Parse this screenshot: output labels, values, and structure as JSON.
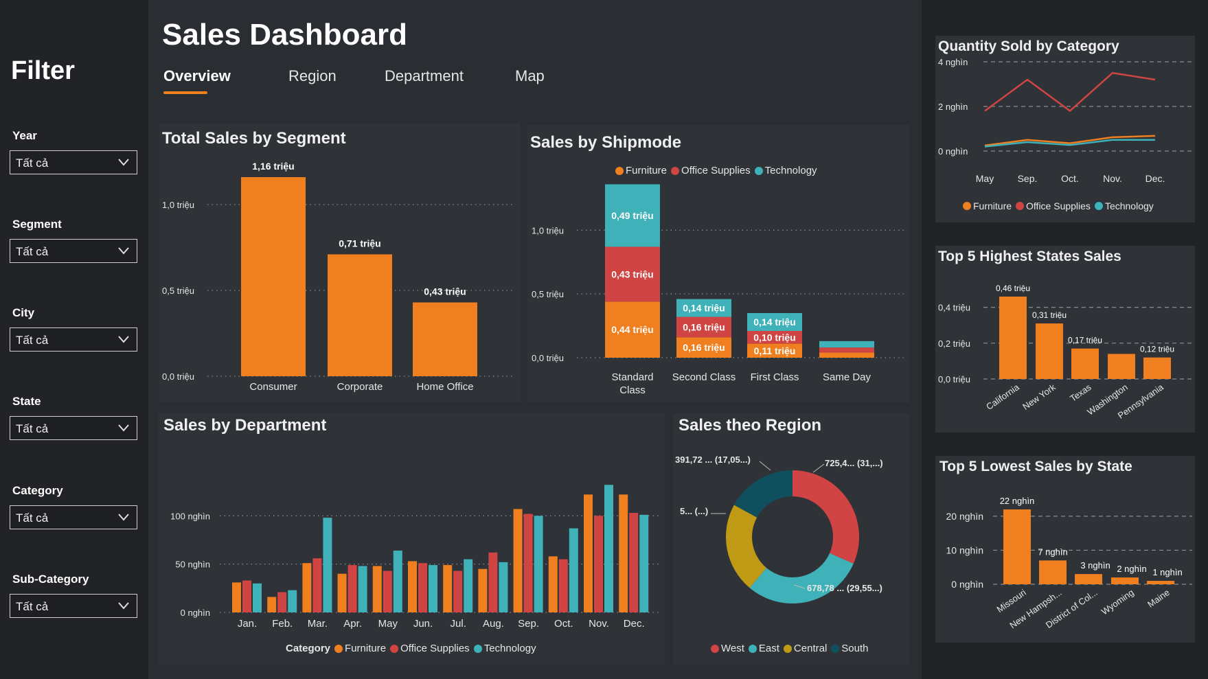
{
  "filter": {
    "title": "Filter",
    "fields": [
      {
        "label": "Year",
        "value": "Tất cả"
      },
      {
        "label": "Segment",
        "value": "Tất cả"
      },
      {
        "label": "City",
        "value": "Tất cả"
      },
      {
        "label": "State",
        "value": "Tất cả"
      },
      {
        "label": "Category",
        "value": "Tất cả"
      },
      {
        "label": "Sub-Category",
        "value": "Tất cả"
      }
    ]
  },
  "header": {
    "title": "Sales Dashboard",
    "tabs": [
      {
        "label": "Overview"
      },
      {
        "label": "Region"
      },
      {
        "label": "Department"
      },
      {
        "label": "Map"
      }
    ]
  },
  "colors": {
    "furniture": "#f07f1f",
    "office": "#d04444",
    "technology": "#3fb1b8",
    "central": "#c19a15",
    "south": "#10505e"
  },
  "chart_data": [
    {
      "id": "segment",
      "type": "bar",
      "title": "Total Sales by Segment",
      "categories": [
        "Consumer",
        "Corporate",
        "Home Office"
      ],
      "values": [
        1.16,
        0.71,
        0.43
      ],
      "data_labels": [
        "1,16 triệu",
        "0,71 triệu",
        "0,43 triệu"
      ],
      "yticks": [
        0,
        0.5,
        1.0
      ],
      "ytick_labels": [
        "0,0 triệu",
        "0,5 triệu",
        "1,0 triệu"
      ],
      "ylim": [
        0,
        1.2
      ],
      "grid": true,
      "color": "#f07f1f"
    },
    {
      "id": "shipmode",
      "type": "bar",
      "stacked": true,
      "title": "Sales by Shipmode",
      "categories": [
        "Standard\nClass",
        "Second Class",
        "First Class",
        "Same Day"
      ],
      "series": [
        {
          "name": "Furniture",
          "values": [
            0.44,
            0.16,
            0.11,
            0.04
          ],
          "labels": [
            "0,44 triệu",
            "0,16 triệu",
            "0,11 triệu",
            ""
          ],
          "color": "#f07f1f"
        },
        {
          "name": "Office Supplies",
          "values": [
            0.43,
            0.16,
            0.1,
            0.04
          ],
          "labels": [
            "0,43 triệu",
            "0,16 triệu",
            "0,10 triệu",
            ""
          ],
          "color": "#d04444"
        },
        {
          "name": "Technology",
          "values": [
            0.49,
            0.14,
            0.14,
            0.05
          ],
          "labels": [
            "0,49 triệu",
            "0,14 triệu",
            "0,14 triệu",
            ""
          ],
          "color": "#3fb1b8"
        }
      ],
      "yticks": [
        0,
        0.5,
        1.0
      ],
      "ytick_labels": [
        "0,0 triệu",
        "0,5 triệu",
        "1,0 triệu"
      ],
      "ylim": [
        0,
        1.4
      ],
      "grid": true,
      "legend": "top-center"
    },
    {
      "id": "department",
      "type": "bar",
      "title": "Sales by Department",
      "categories": [
        "Jan.",
        "Feb.",
        "Mar.",
        "Apr.",
        "May",
        "Jun.",
        "Jul.",
        "Aug.",
        "Sep.",
        "Oct.",
        "Nov.",
        "Dec."
      ],
      "series": [
        {
          "name": "Furniture",
          "values": [
            31,
            16,
            51,
            40,
            48,
            53,
            49,
            45,
            107,
            58,
            122,
            122
          ],
          "color": "#f07f1f"
        },
        {
          "name": "Office Supplies",
          "values": [
            33,
            21,
            56,
            49,
            43,
            51,
            43,
            62,
            102,
            55,
            100,
            103
          ],
          "color": "#d04444"
        },
        {
          "name": "Technology",
          "values": [
            30,
            23,
            98,
            48,
            64,
            49,
            55,
            52,
            100,
            87,
            132,
            101
          ],
          "color": "#3fb1b8"
        }
      ],
      "yticks": [
        0,
        50,
        100
      ],
      "ytick_labels": [
        "0 nghìn",
        "50 nghìn",
        "100 nghìn"
      ],
      "ylim": [
        0,
        135
      ],
      "grid": true,
      "legend_title": "Category",
      "legend": "bottom-center"
    },
    {
      "id": "region",
      "type": "pie",
      "donut": true,
      "title": "Sales theo Region",
      "labels": [
        "West",
        "East",
        "Central",
        "South"
      ],
      "values": [
        725.4,
        678.78,
        501.2,
        391.72
      ],
      "data_labels": [
        "725,4... (31,...)",
        "678,78 ... (29,55...)",
        "5... (...)",
        "391,72 ... (17,05...)"
      ],
      "colors": [
        "#d04444",
        "#3fb1b8",
        "#c19a15",
        "#10505e"
      ],
      "legend": "bottom-center"
    },
    {
      "id": "quantity",
      "type": "line",
      "title": "Quantity Sold by Category",
      "categories": [
        "May",
        "Sep.",
        "Oct.",
        "Nov.",
        "Dec."
      ],
      "series": [
        {
          "name": "Furniture",
          "values": [
            0.25,
            0.5,
            0.35,
            0.62,
            0.68
          ],
          "color": "#f07f1f"
        },
        {
          "name": "Office Supplies",
          "values": [
            1.8,
            3.2,
            1.8,
            3.5,
            3.2
          ],
          "color": "#d04444"
        },
        {
          "name": "Technology",
          "values": [
            0.2,
            0.4,
            0.27,
            0.5,
            0.5
          ],
          "color": "#3fb1b8"
        }
      ],
      "yticks": [
        0,
        2,
        4
      ],
      "ytick_labels": [
        "0 nghìn",
        "2 nghìn",
        "4 nghìn"
      ],
      "ylim": [
        0,
        4
      ],
      "grid": true,
      "legend": "bottom-center"
    },
    {
      "id": "topstates",
      "type": "bar",
      "title": "Top 5 Highest States Sales",
      "categories": [
        "California",
        "New York",
        "Texas",
        "Washington",
        "Pennsylvania"
      ],
      "values": [
        0.46,
        0.31,
        0.17,
        0.14,
        0.12
      ],
      "data_labels": [
        "0,46 triệu",
        "0,31 triệu",
        "0,17 triệu",
        "",
        "0,12 triệu"
      ],
      "yticks": [
        0,
        0.2,
        0.4
      ],
      "ytick_labels": [
        "0,0 triệu",
        "0,2 triệu",
        "0,4 triệu"
      ],
      "ylim": [
        0,
        0.46
      ],
      "grid": true,
      "color": "#f07f1f"
    },
    {
      "id": "lowstates",
      "type": "bar",
      "title": "Top 5 Lowest Sales by State",
      "categories": [
        "Missouri",
        "New Hampsh...",
        "District of Col...",
        "Wyoming",
        "Maine"
      ],
      "values": [
        22,
        7,
        3,
        2,
        1
      ],
      "data_labels": [
        "22 nghìn",
        "7 nghìn",
        "3 nghìn",
        "2 nghìn",
        "1 nghìn"
      ],
      "yticks": [
        0,
        10,
        20
      ],
      "ytick_labels": [
        "0 nghìn",
        "10 nghìn",
        "20 nghìn"
      ],
      "ylim": [
        0,
        22
      ],
      "grid": true,
      "color": "#f07f1f"
    }
  ]
}
